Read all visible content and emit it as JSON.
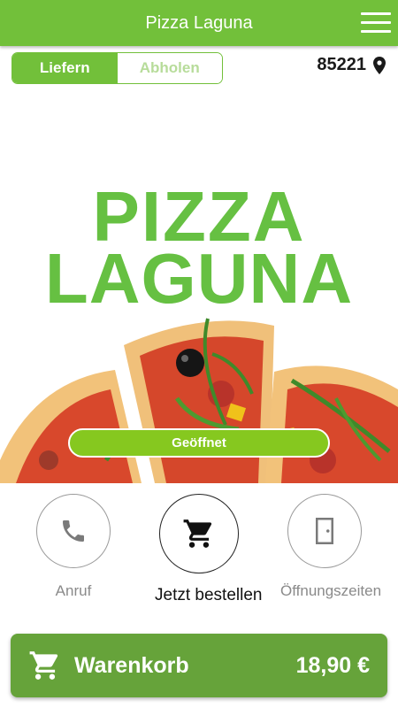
{
  "header": {
    "title": "Pizza Laguna",
    "menu_icon": "hamburger-menu-icon"
  },
  "order_mode": {
    "options": [
      {
        "label": "Liefern",
        "active": true
      },
      {
        "label": "Abholen",
        "active": false
      }
    ]
  },
  "location": {
    "zip": "85221",
    "icon": "map-pin-icon"
  },
  "hero": {
    "brand_line1": "PIZZA",
    "brand_line2": "LAGUNA",
    "status": "Geöffnet"
  },
  "actions": [
    {
      "label": "Anruf",
      "icon": "phone-icon"
    },
    {
      "label": "Jetzt bestellen",
      "icon": "shopping-cart-icon"
    },
    {
      "label": "Öffnungszeiten",
      "icon": "door-icon"
    }
  ],
  "cart": {
    "label": "Warenkorb",
    "total": "18,90 €",
    "icon": "shopping-cart-icon"
  },
  "colors": {
    "primary": "#72c03a",
    "status": "#86c81f",
    "cart": "#66a33a",
    "brand_text": "#66c042"
  }
}
